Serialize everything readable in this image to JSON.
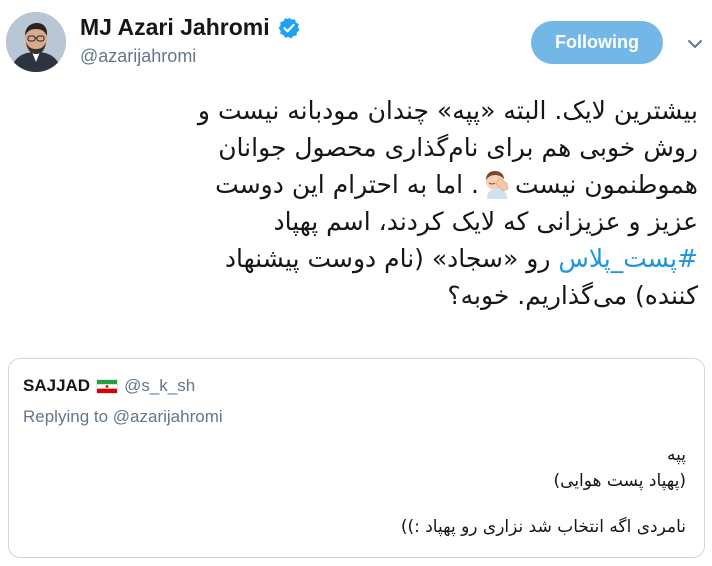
{
  "colors": {
    "accent": "#1b95e0",
    "follow_button": "#73b7e7",
    "secondary_text": "#657786",
    "border": "#ccd6dd"
  },
  "header": {
    "display_name": "MJ Azari Jahromi",
    "handle": "@azarijahromi",
    "verified_icon": "verified-badge-icon",
    "follow_label": "Following",
    "more_icon": "chevron-down-icon"
  },
  "tweet": {
    "line1": "بیشترین لایک. البته «پپه» چندان مودبانه نیست و",
    "line2": "روش خوبی هم برای نام‌گذاری محصول جوانان",
    "line3_a": "هموطنمون نیست",
    "line3_b": ". اما به احترام این دوست",
    "line4": "عزیز و عزیزانی که لایک کردند، اسم پهپاد",
    "hashtag": "#پست_پلاس",
    "line5_rest": " رو «سجاد» (نام دوست پیشنهاد",
    "line6": "کننده) می‌گذاریم. خوبه؟",
    "emoji": "facepalm-emoji"
  },
  "quote": {
    "name": "SAJJAD",
    "flag_icon": "iran-flag-icon",
    "handle": "@s_k_sh",
    "replying_prefix": "Replying to ",
    "replying_to": "@azarijahromi",
    "body_line1": "پپه",
    "body_line2": "(پهپاد پست هوایی)",
    "body_line3": "نامردی اگه انتخاب شد نزاری رو پهپاد :))"
  }
}
